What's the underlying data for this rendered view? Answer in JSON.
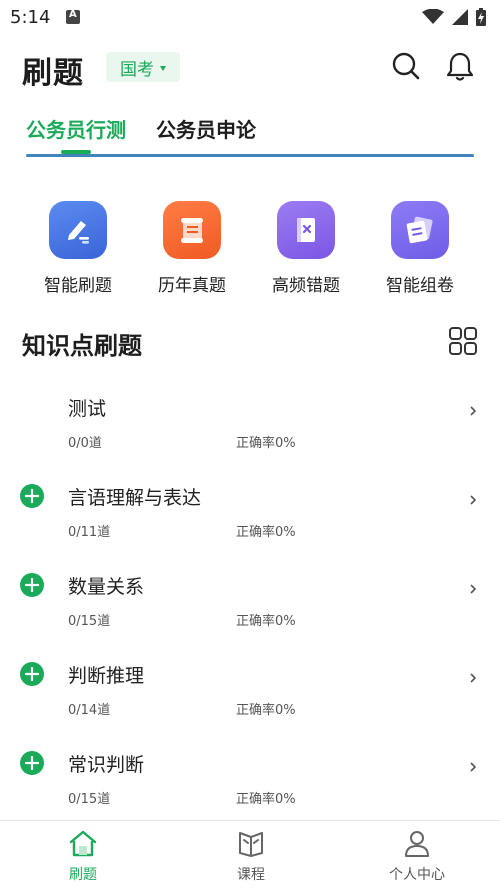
{
  "status": {
    "time": "5:14",
    "icons": [
      "app-a-icon",
      "wifi-icon",
      "signal-icon",
      "battery-charging-icon"
    ]
  },
  "header": {
    "title": "刷题",
    "exam_type": "国考",
    "icons": [
      "search-icon",
      "bell-icon"
    ]
  },
  "tabs": [
    {
      "label": "公务员行测",
      "active": true
    },
    {
      "label": "公务员申论",
      "active": false
    }
  ],
  "features": [
    {
      "label": "智能刷题",
      "icon": "pen-icon",
      "color": "#4a78e6"
    },
    {
      "label": "历年真题",
      "icon": "scroll-icon",
      "color": "#f26a30"
    },
    {
      "label": "高频错题",
      "icon": "notebook-x-icon",
      "color": "#8b6cf0"
    },
    {
      "label": "智能组卷",
      "icon": "papers-icon",
      "color": "#7f6df0"
    }
  ],
  "section": {
    "title": "知识点刷题",
    "grid_icon": "grid-view-icon"
  },
  "knowledge_items": [
    {
      "name": "测试",
      "count": "0/0道",
      "rate": "正确率0%",
      "expandable": false
    },
    {
      "name": "言语理解与表达",
      "count": "0/11道",
      "rate": "正确率0%",
      "expandable": true
    },
    {
      "name": "数量关系",
      "count": "0/15道",
      "rate": "正确率0%",
      "expandable": true
    },
    {
      "name": "判断推理",
      "count": "0/14道",
      "rate": "正确率0%",
      "expandable": true
    },
    {
      "name": "常识判断",
      "count": "0/15道",
      "rate": "正确率0%",
      "expandable": true
    }
  ],
  "bottom_nav": [
    {
      "label": "刷题",
      "icon": "home-icon",
      "active": true
    },
    {
      "label": "课程",
      "icon": "book-icon",
      "active": false
    },
    {
      "label": "个人中心",
      "icon": "person-icon",
      "active": false
    }
  ],
  "colors": {
    "accent": "#1aaa5a",
    "accent_light": "#eaf7ee",
    "tab_underline": "#1f6fb0"
  }
}
